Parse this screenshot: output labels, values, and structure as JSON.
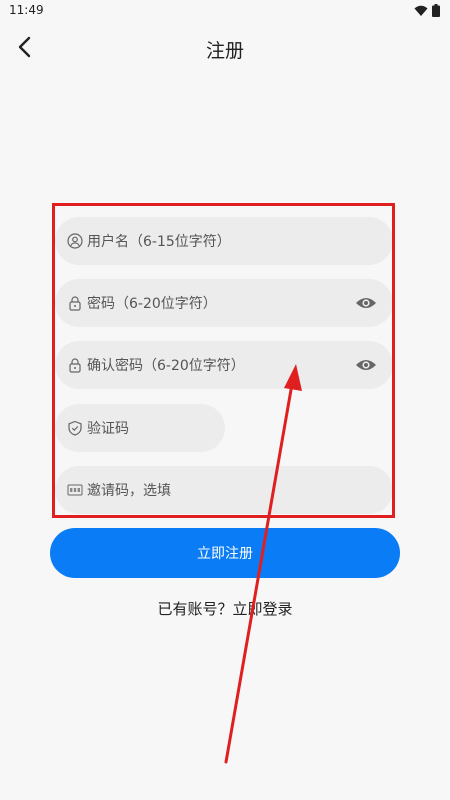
{
  "status_bar": {
    "time": "11:49"
  },
  "header": {
    "title": "注册"
  },
  "form": {
    "username_placeholder": "用户名（6-15位字符）",
    "password_placeholder": "密码（6-20位字符）",
    "confirm_password_placeholder": "确认密码（6-20位字符）",
    "verification_code_placeholder": "验证码",
    "invite_code_placeholder": "邀请码，选填"
  },
  "actions": {
    "register_button": "立即注册",
    "login_prompt": "已有账号？",
    "login_link": "立即登录"
  },
  "colors": {
    "primary": "#0a7cf5",
    "annotation": "#e02020",
    "field_bg": "#ececec"
  },
  "icons": [
    "back-arrow-icon",
    "wifi-icon",
    "battery-icon",
    "user-icon",
    "lock-icon",
    "eye-icon",
    "shield-icon",
    "abc-icon"
  ]
}
